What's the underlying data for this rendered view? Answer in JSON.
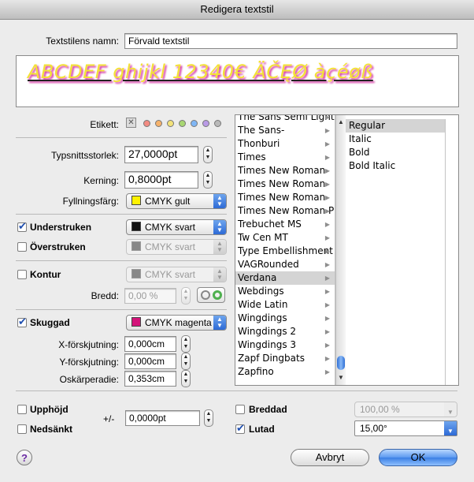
{
  "window": {
    "title": "Redigera textstil"
  },
  "name": {
    "label": "Textstilens namn:",
    "value": "Förvald textstil"
  },
  "preview": {
    "text": "ABCDEF ghijkl 12340€ ÄČĘØ àçéøß"
  },
  "tags": {
    "label": "Etikett:",
    "colors": [
      "#f28b82",
      "#f6b26b",
      "#f3e27a",
      "#a8d672",
      "#7fb6f5",
      "#b99be6",
      "#b9b9b9"
    ]
  },
  "size": {
    "label": "Typsnittsstorlek:",
    "value": "27,0000pt"
  },
  "kerning": {
    "label": "Kerning:",
    "value": "0,8000pt"
  },
  "fill": {
    "label": "Fyllningsfärg:",
    "value": "CMYK gult",
    "color": "#fff200"
  },
  "underline": {
    "label": "Understruken",
    "checked": true,
    "value": "CMYK svart",
    "color": "#111111"
  },
  "strike": {
    "label": "Överstruken",
    "checked": false,
    "value": "CMYK svart",
    "color": "#888888"
  },
  "outline": {
    "label": "Kontur",
    "checked": false,
    "value": "CMYK svart",
    "color": "#888888",
    "width_label": "Bredd:",
    "width_value": "0,00 %"
  },
  "shadow": {
    "label": "Skuggad",
    "checked": true,
    "value": "CMYK magenta",
    "color": "#d4147a",
    "x_label": "X-förskjutning:",
    "x_value": "0,000cm",
    "y_label": "Y-förskjutning:",
    "y_value": "0,000cm",
    "blur_label": "Oskärperadie:",
    "blur_value": "0,353cm"
  },
  "fonts": [
    "The Sans Semi Light",
    "The Sans-",
    "Thonburi",
    "Times",
    "Times New Roman",
    "Times New Roman",
    "Times New Roman",
    "Times New Roman P",
    "Trebuchet MS",
    "Tw Cen MT",
    "Type Embellishment",
    "VAGRounded",
    "Verdana",
    "Webdings",
    "Wide Latin",
    "Wingdings",
    "Wingdings 2",
    "Wingdings 3",
    "Zapf Dingbats",
    "Zapfino"
  ],
  "selected_font": "Verdana",
  "styles": [
    "Regular",
    "Italic",
    "Bold",
    "Bold Italic"
  ],
  "selected_style": "Regular",
  "superscript": {
    "label": "Upphöjd",
    "checked": false
  },
  "subscript": {
    "label": "Nedsänkt",
    "checked": false
  },
  "offset": {
    "label": "+/-",
    "value": "0,0000pt"
  },
  "width": {
    "label": "Breddad",
    "checked": false,
    "value": "100,00 %"
  },
  "italic": {
    "label": "Lutad",
    "checked": true,
    "value": "15,00°"
  },
  "buttons": {
    "help": "?",
    "cancel": "Avbryt",
    "ok": "OK"
  }
}
